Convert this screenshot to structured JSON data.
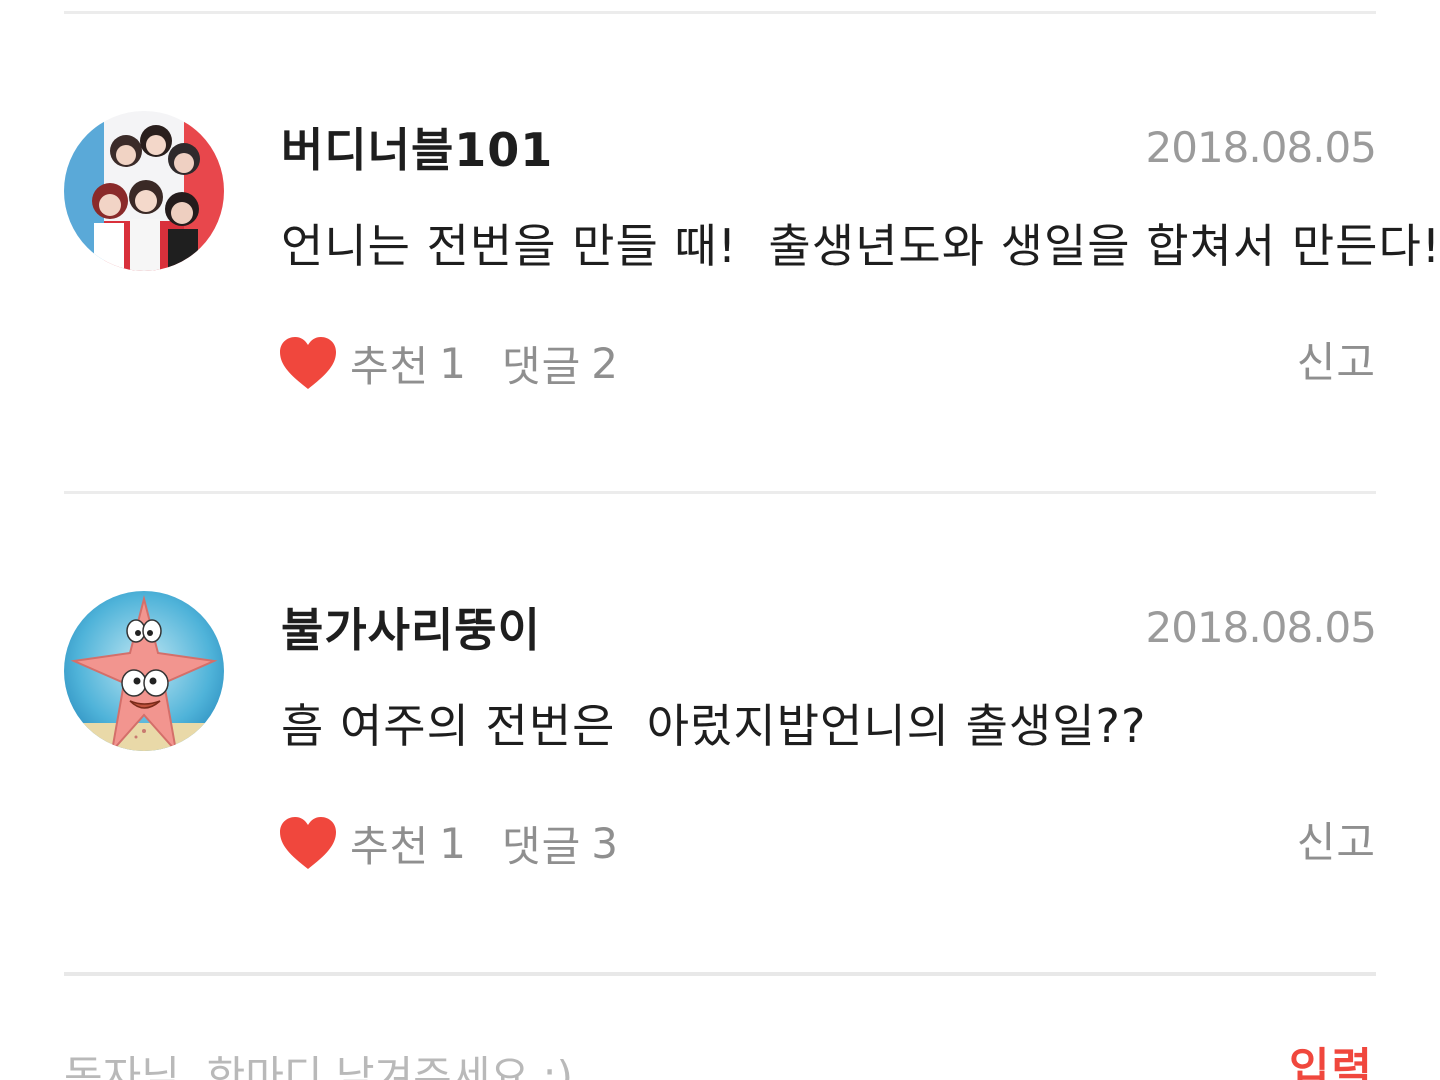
{
  "comments": [
    {
      "username": "버디너블101",
      "date": "2018.08.05",
      "text": "언니는 전번을 만들 때!  출생년도와 생일을 합쳐서 만든다!",
      "like_label": "추천",
      "like_count": "1",
      "reply_label": "댓글",
      "reply_count": "2",
      "report_label": "신고",
      "avatar": "group-photo-avatar"
    },
    {
      "username": "불가사리뚱이",
      "date": "2018.08.05",
      "text": "흠 여주의 전번은  아렀지밥언니의 출생일??",
      "like_label": "추천",
      "like_count": "1",
      "reply_label": "댓글",
      "reply_count": "3",
      "report_label": "신고",
      "avatar": "starfish-cartoon-avatar"
    }
  ],
  "composer": {
    "placeholder": "독자님, 한마디 남겨주세요 :)",
    "submit_label": "입력"
  },
  "colors": {
    "heart": "#f0473d",
    "submit": "#f0473d",
    "muted_text": "#8f8f8f",
    "date_text": "#9b9b9b",
    "divider": "#ececec"
  },
  "icons": {
    "like": "heart-icon"
  }
}
